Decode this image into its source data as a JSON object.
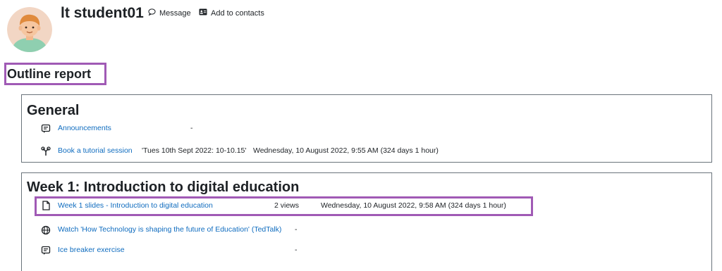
{
  "user": {
    "name": "lt student01"
  },
  "header_actions": {
    "message": "Message",
    "add_contacts": "Add to contacts"
  },
  "report": {
    "title": "Outline report"
  },
  "colors": {
    "accent_highlight": "#a05ab5",
    "link": "#0f6cbf"
  },
  "sections": [
    {
      "title": "General",
      "activities": [
        {
          "icon": "forum-icon",
          "name": "Announcements",
          "views": "",
          "detail": "-"
        },
        {
          "icon": "scheduler-icon",
          "name": "Book a tutorial session",
          "views": "'Tues 10th Sept 2022: 10-10.15'",
          "detail": "Wednesday, 10 August 2022, 9:55 AM (324 days 1 hour)"
        }
      ]
    },
    {
      "title": "Week 1: Introduction to digital education",
      "activities": [
        {
          "icon": "file-icon",
          "name": "Week 1 slides - Introduction to digital education",
          "views": "2 views",
          "detail": "Wednesday, 10 August 2022, 9:58 AM (324 days 1 hour)"
        },
        {
          "icon": "url-globe-icon",
          "name": "Watch 'How Technology is shaping the future of Education' (TedTalk)",
          "views": "",
          "detail": "-"
        },
        {
          "icon": "forum-icon",
          "name": "Ice breaker exercise",
          "views": "",
          "detail": "-"
        }
      ]
    }
  ]
}
